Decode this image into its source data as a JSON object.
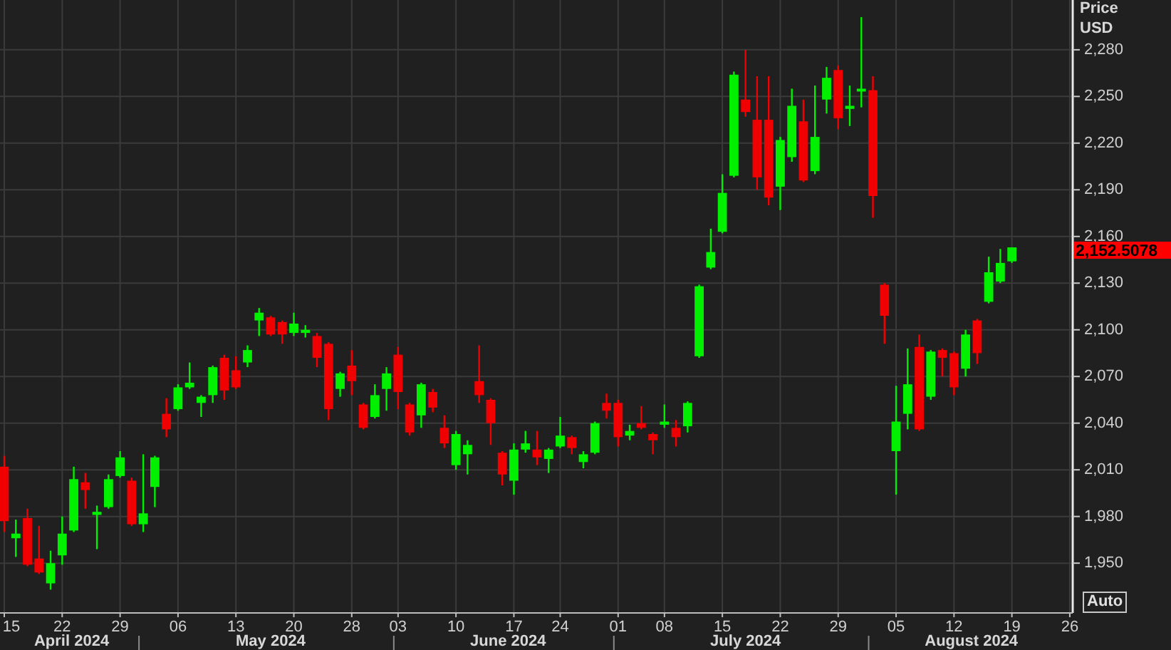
{
  "chart": {
    "axis_header": [
      "Price",
      "USD"
    ],
    "last_price": "2,152.5078",
    "auto_button": "Auto",
    "months": [
      "April 2024",
      "May 2024",
      "June 2024",
      "July 2024",
      "August 2024"
    ],
    "chart_data": {
      "type": "candlestick",
      "grid": true,
      "ylim": [
        1918,
        2312
      ],
      "categories": [
        "15",
        null,
        null,
        null,
        null,
        "22",
        null,
        null,
        null,
        null,
        "29",
        null,
        null,
        null,
        null,
        "06",
        null,
        null,
        null,
        null,
        "13",
        null,
        null,
        null,
        null,
        "20",
        null,
        null,
        null,
        null,
        "28",
        null,
        null,
        null,
        "03",
        null,
        null,
        null,
        null,
        "10",
        null,
        null,
        null,
        null,
        "17",
        null,
        null,
        null,
        "24",
        null,
        null,
        null,
        null,
        "01",
        null,
        null,
        null,
        "08",
        null,
        null,
        null,
        null,
        "15",
        null,
        null,
        null,
        null,
        "22",
        null,
        null,
        null,
        null,
        "29",
        null,
        null,
        null,
        null,
        "05",
        null,
        null,
        null,
        null,
        "12",
        null,
        null,
        null,
        null,
        "19",
        null,
        null,
        null,
        null,
        "26"
      ],
      "ohlc": [
        [
          2012,
          2019,
          1970,
          1977
        ],
        [
          1966,
          1978,
          1954,
          1969
        ],
        [
          1979,
          1985,
          1948,
          1949
        ],
        [
          1953,
          1974,
          1943,
          1944
        ],
        [
          1937,
          1958,
          1933,
          1950
        ],
        [
          1955,
          1980,
          1949,
          1969
        ],
        [
          1971,
          2012,
          1970,
          2004
        ],
        [
          2002,
          2008,
          1985,
          1997
        ],
        [
          1981,
          1987,
          1959,
          1983
        ],
        [
          1986,
          2007,
          1985,
          2004
        ],
        [
          2006,
          2022,
          2005,
          2018
        ],
        [
          2003,
          2005,
          1974,
          1975
        ],
        [
          1975,
          2020,
          1970,
          1982
        ],
        [
          1999,
          2019,
          1986,
          2018
        ],
        [
          2046,
          2056,
          2031,
          2036
        ],
        [
          2049,
          2065,
          2048,
          2063
        ],
        [
          2063,
          2079,
          2062,
          2066
        ],
        [
          2053,
          2058,
          2044,
          2057
        ],
        [
          2058,
          2077,
          2053,
          2076
        ],
        [
          2082,
          2084,
          2055,
          2061
        ],
        [
          2074,
          2083,
          2062,
          2063
        ],
        [
          2079,
          2090,
          2076,
          2087
        ],
        [
          2106,
          2114,
          2096,
          2111
        ],
        [
          2108,
          2109,
          2096,
          2097
        ],
        [
          2105,
          2106,
          2091,
          2097
        ],
        [
          2098,
          2111,
          2096,
          2104
        ],
        [
          2098,
          2103,
          2095,
          2100
        ],
        [
          2096,
          2098,
          2076,
          2082
        ],
        [
          2091,
          2092,
          2042,
          2049
        ],
        [
          2062,
          2073,
          2057,
          2072
        ],
        [
          2077,
          2087,
          2058,
          2067
        ],
        [
          2052,
          2053,
          2036,
          2037
        ],
        [
          2044,
          2065,
          2043,
          2058
        ],
        [
          2062,
          2076,
          2048,
          2072
        ],
        [
          2084,
          2089,
          2049,
          2060
        ],
        [
          2052,
          2053,
          2032,
          2034
        ],
        [
          2045,
          2066,
          2037,
          2065
        ],
        [
          2060,
          2062,
          2047,
          2050
        ],
        [
          2037,
          2045,
          2024,
          2027
        ],
        [
          2013,
          2035,
          2010,
          2033
        ],
        [
          2020,
          2029,
          2007,
          2026
        ],
        [
          2067,
          2090,
          2053,
          2058
        ],
        [
          2055,
          2056,
          2026,
          2040
        ],
        [
          2021,
          2022,
          2000,
          2007
        ],
        [
          2003,
          2027,
          1994,
          2023
        ],
        [
          2023,
          2035,
          2021,
          2027
        ],
        [
          2023,
          2035,
          2013,
          2018
        ],
        [
          2017,
          2024,
          2008,
          2023
        ],
        [
          2025,
          2044,
          2024,
          2032
        ],
        [
          2031,
          2032,
          2020,
          2024
        ],
        [
          2015,
          2022,
          2011,
          2020
        ],
        [
          2021,
          2041,
          2020,
          2040
        ],
        [
          2053,
          2059,
          2043,
          2048
        ],
        [
          2053,
          2055,
          2025,
          2031
        ],
        [
          2032,
          2039,
          2029,
          2035
        ],
        [
          2040,
          2051,
          2036,
          2037
        ],
        [
          2033,
          2034,
          2020,
          2029
        ],
        [
          2039,
          2052,
          2037,
          2041
        ],
        [
          2037,
          2042,
          2025,
          2031
        ],
        [
          2038,
          2054,
          2034,
          2053
        ],
        [
          2083,
          2129,
          2082,
          2128
        ],
        [
          2140,
          2165,
          2139,
          2150
        ],
        [
          2163,
          2200,
          2162,
          2188
        ],
        [
          2199,
          2266,
          2198,
          2264
        ],
        [
          2248,
          2280,
          2237,
          2240
        ],
        [
          2235,
          2263,
          2190,
          2198
        ],
        [
          2235,
          2263,
          2180,
          2185
        ],
        [
          2192,
          2224,
          2177,
          2222
        ],
        [
          2211,
          2255,
          2208,
          2244
        ],
        [
          2234,
          2248,
          2195,
          2196
        ],
        [
          2202,
          2257,
          2200,
          2224
        ],
        [
          2248,
          2269,
          2239,
          2262
        ],
        [
          2267,
          2270,
          2229,
          2236
        ],
        [
          2242,
          2257,
          2231,
          2244
        ],
        [
          2254,
          2301,
          2243,
          2255
        ],
        [
          2254,
          2263,
          2172,
          2186
        ],
        [
          2129,
          2130,
          2091,
          2109
        ],
        [
          2022,
          2064,
          1994,
          2041
        ],
        [
          2046,
          2088,
          2036,
          2065
        ],
        [
          2089,
          2097,
          2035,
          2036
        ],
        [
          2057,
          2087,
          2055,
          2086
        ],
        [
          2087,
          2088,
          2070,
          2082
        ],
        [
          2085,
          2086,
          2058,
          2063
        ],
        [
          2075,
          2100,
          2070,
          2097
        ],
        [
          2106,
          2107,
          2078,
          2085
        ],
        [
          2118,
          2147,
          2117,
          2137
        ],
        [
          2131,
          2152,
          2130,
          2143
        ],
        [
          2144,
          2153,
          2143,
          2153
        ],
        null,
        null,
        null,
        null,
        null
      ],
      "yticks": [
        {
          "value": 2280,
          "label": "2,280"
        },
        {
          "value": 2250,
          "label": "2,250"
        },
        {
          "value": 2220,
          "label": "2,220"
        },
        {
          "value": 2190,
          "label": "2,190"
        },
        {
          "value": 2160,
          "label": "2,160"
        },
        {
          "value": 2130,
          "label": "2,130"
        },
        {
          "value": 2100,
          "label": "2,100"
        },
        {
          "value": 2070,
          "label": "2,070"
        },
        {
          "value": 2040,
          "label": "2,040"
        },
        {
          "value": 2010,
          "label": "2,010"
        },
        {
          "value": 1980,
          "label": "1,980"
        },
        {
          "value": 1950,
          "label": "1,950"
        }
      ]
    }
  }
}
